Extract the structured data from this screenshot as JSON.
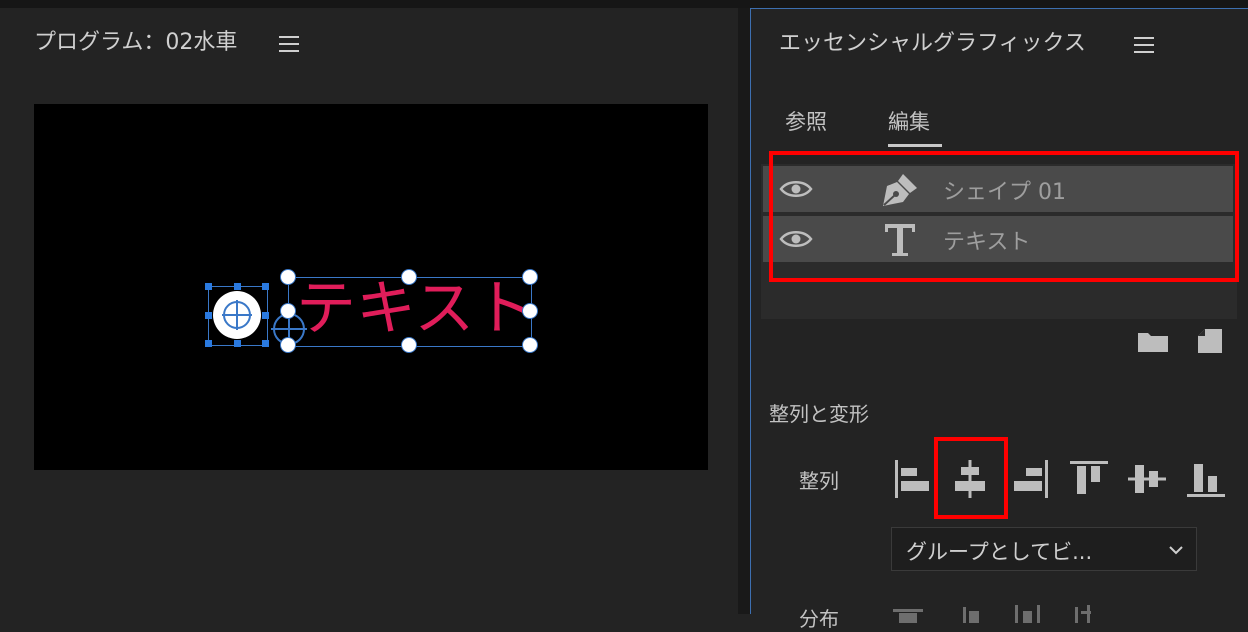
{
  "program": {
    "title": "プログラム：02水車",
    "canvas_text": "テキスト"
  },
  "essential_graphics": {
    "title": "エッセンシャルグラフィックス",
    "tabs": [
      {
        "label": "参照"
      },
      {
        "label": "編集",
        "active": true
      }
    ],
    "layers": [
      {
        "name": "シェイプ 01",
        "icon": "pen-icon",
        "visible": true
      },
      {
        "name": "テキスト",
        "icon": "text-t-icon",
        "visible": true
      }
    ],
    "section_title": "整列と変形",
    "align_label": "整列",
    "align_buttons": [
      "align-left",
      "align-center-horizontal",
      "align-right",
      "align-top",
      "align-center-vertical",
      "align-bottom"
    ],
    "align_to": "グループとしてビ...",
    "distribute_label": "分布"
  },
  "colors": {
    "highlight": "#ff0000",
    "canvas_text": "#e01d5a",
    "selection": "#2a7ae0"
  }
}
